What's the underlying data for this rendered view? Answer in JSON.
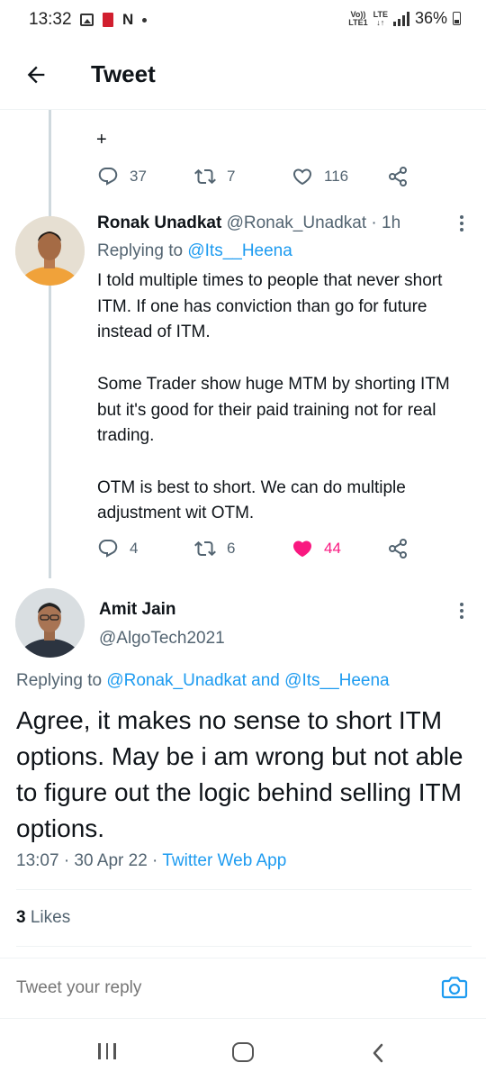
{
  "status_bar": {
    "time": "13:32",
    "notif_letter": "N",
    "volte_line1": "Vo))",
    "volte_line2": "LTE1",
    "lte": "LTE",
    "battery": "36%"
  },
  "header": {
    "title": "Tweet"
  },
  "prev_tweet": {
    "trailing_text": "+",
    "replies": "37",
    "retweets": "7",
    "likes": "116"
  },
  "reply": {
    "name": "Ronak Unadkat",
    "handle": "@Ronak_Unadkat",
    "time": "· 1h",
    "replying_prefix": "Replying to ",
    "replying_to": "@Its__Heena",
    "paragraphs": [
      "I told multiple times to people that never short ITM. If one has conviction than go for future instead of ITM.",
      "Some Trader show huge MTM by shorting ITM but it's good for their paid training not for real trading.",
      "OTM is best to short. We can do multiple adjustment wit OTM."
    ],
    "replies": "4",
    "retweets": "6",
    "likes": "44",
    "liked_color": "#f91880"
  },
  "main_tweet": {
    "name": "Amit Jain",
    "handle": "@AlgoTech2021",
    "replying_prefix": "Replying to ",
    "replying_user1": "@Ronak_Unadkat",
    "replying_and": " and ",
    "replying_user2": "@Its__Heena",
    "text": "Agree, it makes no sense to short ITM options. May be i am wrong but not able to figure out the logic behind selling ITM options.",
    "time": "13:07 · 30 Apr 22 · ",
    "source": "Twitter Web App",
    "likes_count": "3",
    "likes_label": " Likes"
  },
  "reply_bar": {
    "placeholder": "Tweet your reply"
  },
  "colors": {
    "accent": "#1d9bf0",
    "secondary_text": "#536471",
    "like": "#f91880"
  },
  "icons": [
    "back-arrow-icon",
    "reply-icon",
    "retweet-icon",
    "like-icon",
    "share-icon",
    "more-icon",
    "camera-icon",
    "recents-icon",
    "home-icon",
    "nav-back-icon"
  ]
}
